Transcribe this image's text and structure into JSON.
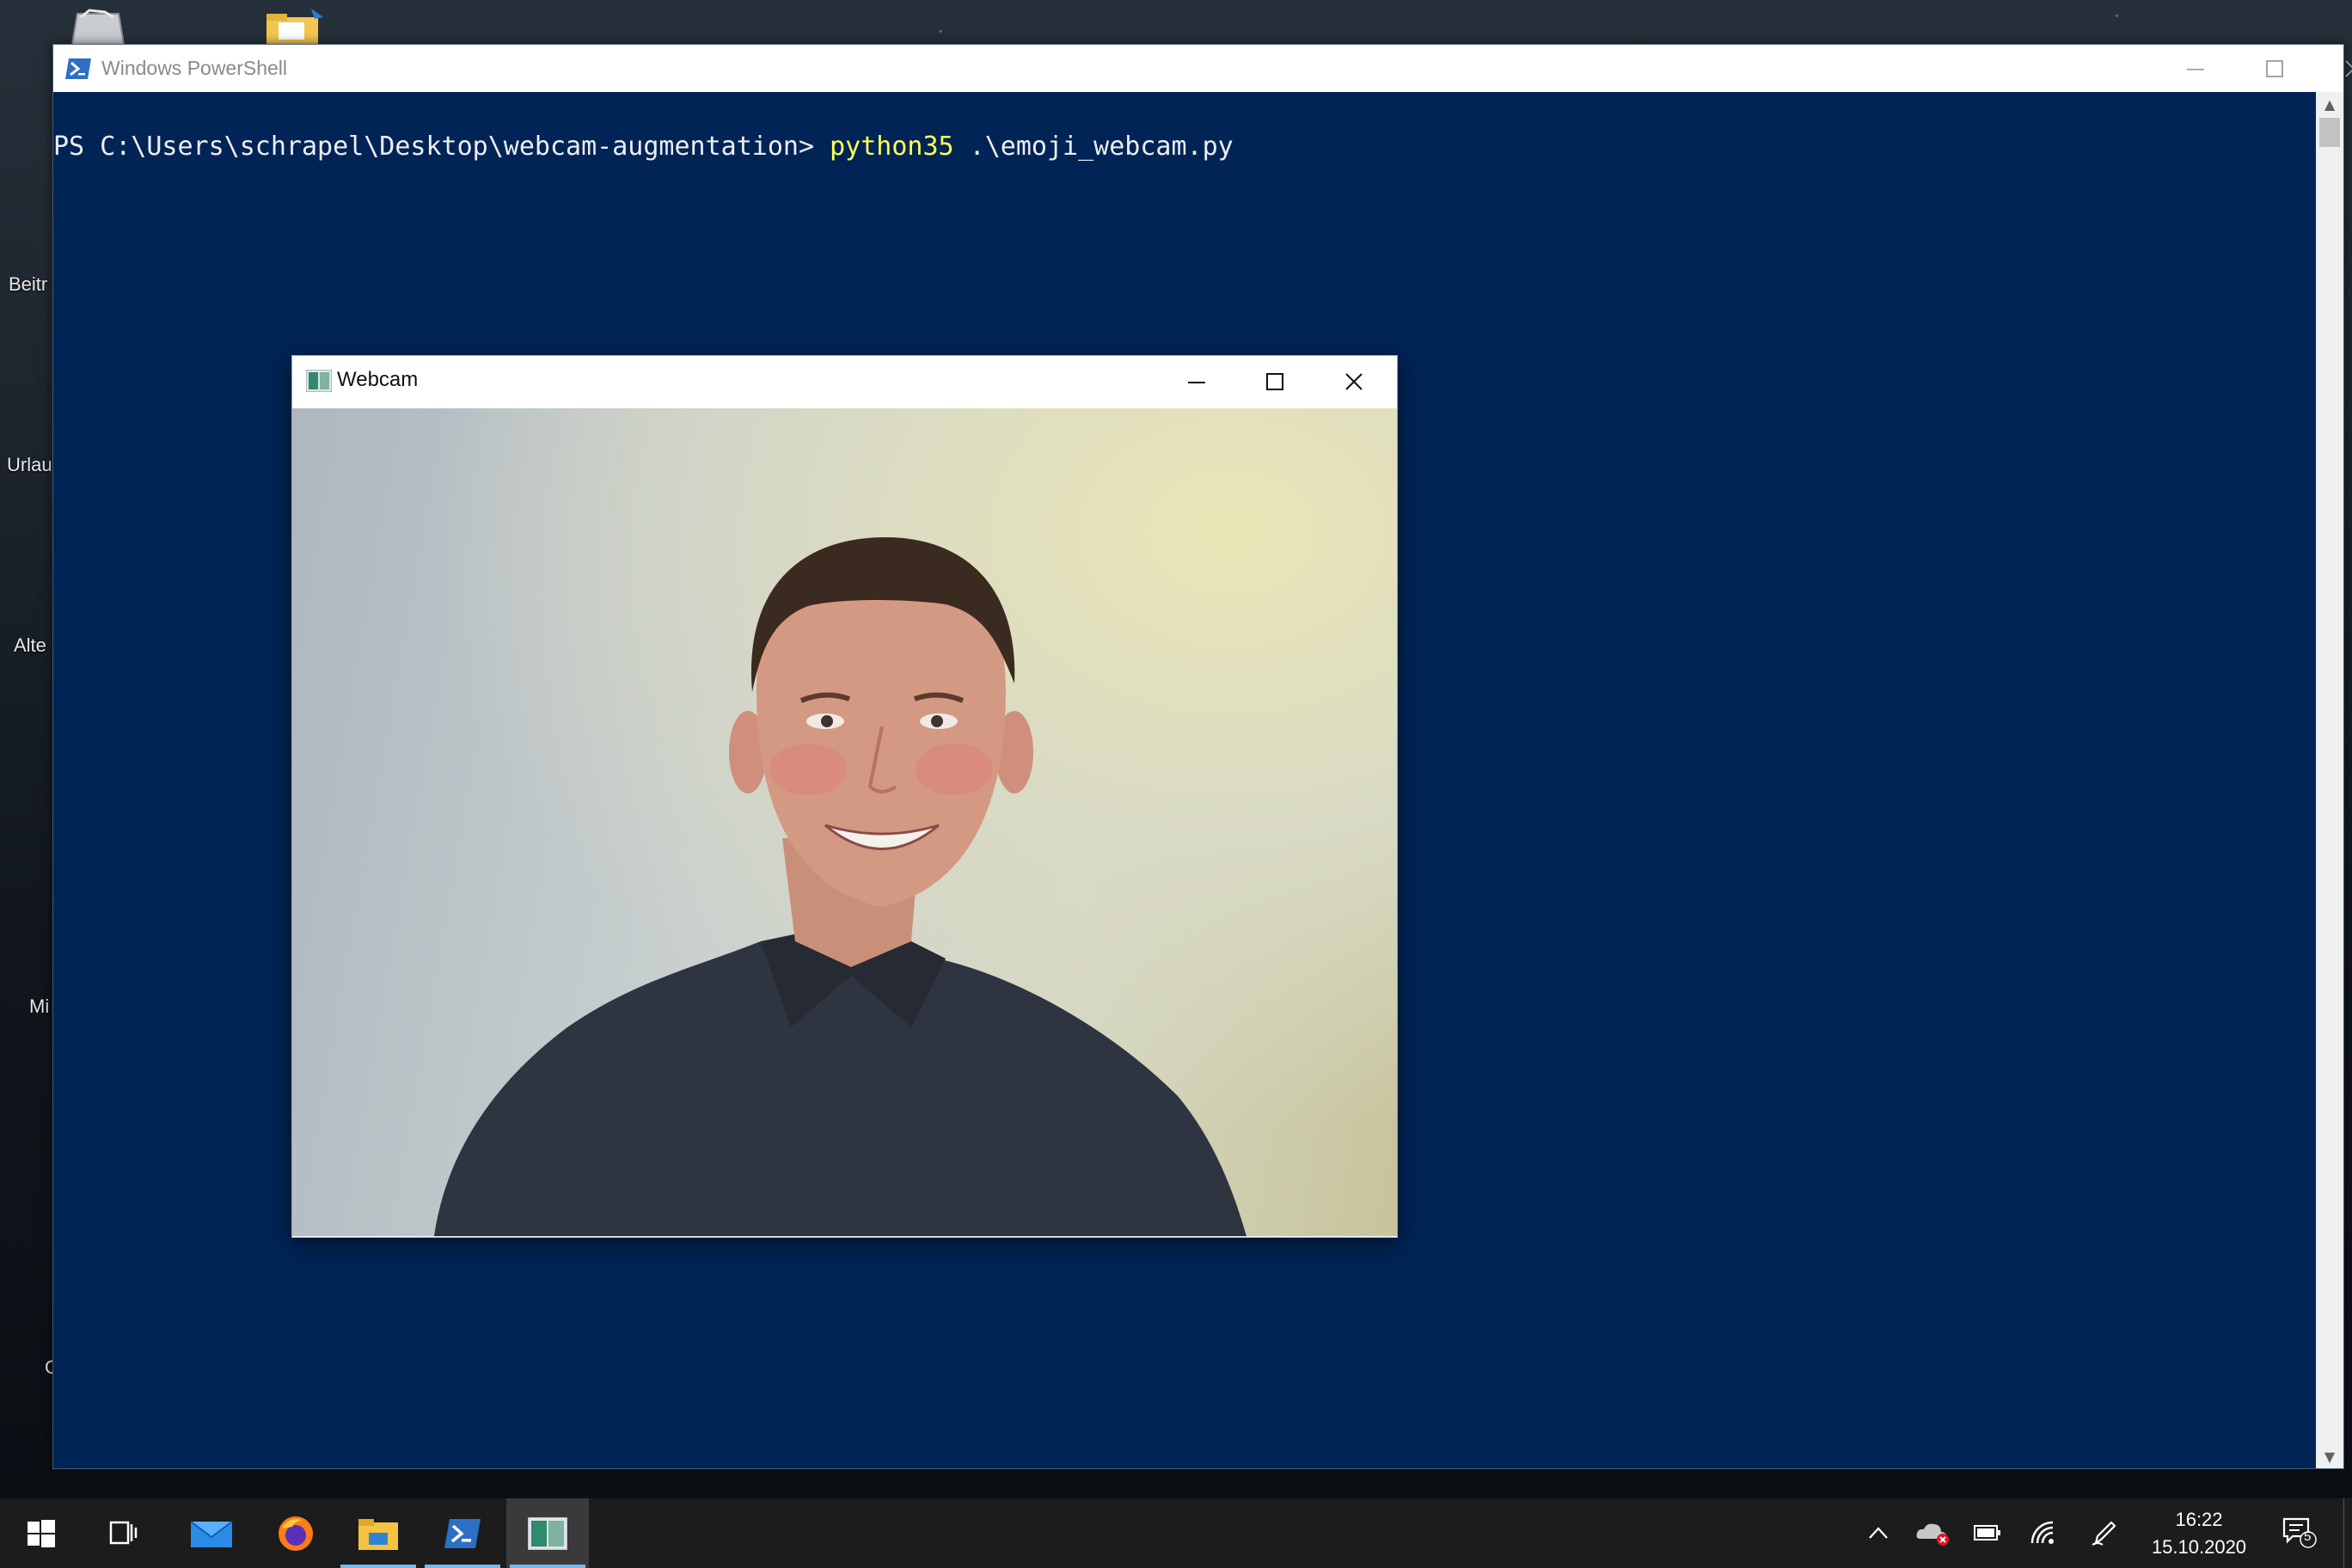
{
  "desktop": {
    "labels": [
      "Beitr",
      "Urlau",
      "Alte",
      "Mi",
      "C"
    ]
  },
  "powershell": {
    "title": "Windows PowerShell",
    "prompt": "PS C:\\Users\\schrapel\\Desktop\\webcam-augmentation> ",
    "command": "python35",
    "args": " .\\emoji_webcam.py",
    "colors": {
      "background": "#012456",
      "prompt_text": "#eeedf0",
      "command_text": "#ffff55"
    }
  },
  "webcam": {
    "title": "Webcam"
  },
  "taskbar": {
    "items": [
      {
        "name": "start",
        "icon": "windows-logo"
      },
      {
        "name": "task-view",
        "icon": "task-view-icon"
      },
      {
        "name": "mail",
        "icon": "mail-icon"
      },
      {
        "name": "firefox",
        "icon": "firefox-icon"
      },
      {
        "name": "file-explorer",
        "icon": "folder-icon"
      },
      {
        "name": "powershell",
        "icon": "powershell-icon"
      },
      {
        "name": "webcam",
        "icon": "webcam-app-icon"
      }
    ],
    "clock": {
      "time": "16:22",
      "date": "15.10.2020"
    },
    "notifications_count": "5"
  }
}
